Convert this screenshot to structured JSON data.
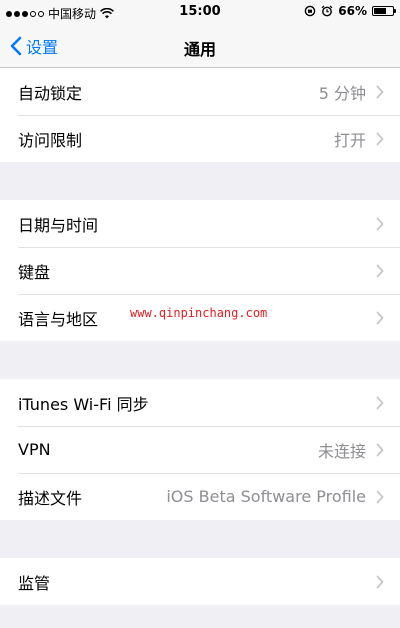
{
  "status_bar": {
    "carrier": "中国移动",
    "time": "15:00",
    "battery_percent": "66%",
    "battery_level": 0.66,
    "signal_dots_filled": 3,
    "signal_dots_total": 5
  },
  "nav": {
    "back_label": "设置",
    "title": "通用",
    "accent_color": "#007aff"
  },
  "groups": [
    {
      "rows": [
        {
          "label": "自动锁定",
          "value": "5 分钟"
        },
        {
          "label": "访问限制",
          "value": "打开"
        }
      ]
    },
    {
      "rows": [
        {
          "label": "日期与时间",
          "value": ""
        },
        {
          "label": "键盘",
          "value": ""
        },
        {
          "label": "语言与地区",
          "value": ""
        }
      ]
    },
    {
      "rows": [
        {
          "label": "iTunes Wi-Fi 同步",
          "value": ""
        },
        {
          "label": "VPN",
          "value": "未连接"
        },
        {
          "label": "描述文件",
          "value": "iOS Beta Software Profile"
        }
      ]
    },
    {
      "rows": [
        {
          "label": "监管",
          "value": ""
        }
      ]
    }
  ],
  "watermark": "www.qinpinchang.com"
}
